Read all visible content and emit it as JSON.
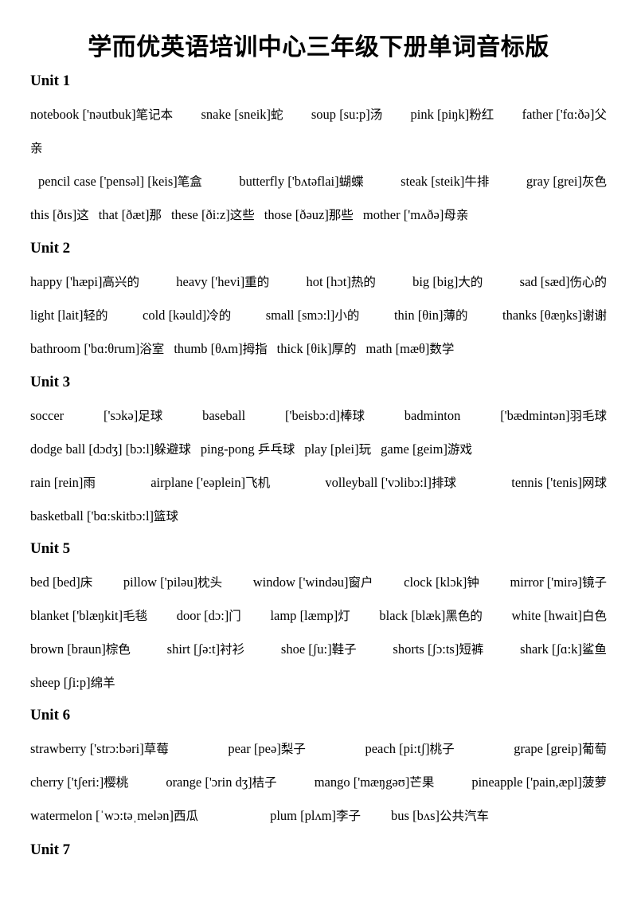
{
  "title": "学而优英语培训中心三年级下册单词音标版",
  "units": [
    {
      "label": "Unit 1",
      "lines": [
        [
          {
            "en": "notebook",
            "ph": "['nəutbuk]",
            "zh": "笔记本"
          },
          {
            "en": "snake",
            "ph": "[sneik]",
            "zh": "蛇"
          },
          {
            "en": "soup",
            "ph": "[su:p]",
            "zh": "汤"
          },
          {
            "en": "pink",
            "ph": "[piŋk]",
            "zh": "粉红"
          },
          {
            "en": "father",
            "ph": "['fɑ:ðə]",
            "zh": "父"
          }
        ],
        [
          {
            "en": "",
            "ph": "",
            "zh": "亲"
          }
        ],
        [
          {
            "en": "pencil case",
            "ph": "['pensəl] [keis]",
            "zh": "笔盒"
          },
          {
            "en": "butterfly",
            "ph": "['bʌtəflai]",
            "zh": "蝴蝶"
          },
          {
            "en": "steak",
            "ph": "[steik]",
            "zh": "牛排"
          },
          {
            "en": "gray",
            "ph": "[grei]",
            "zh": "灰色"
          }
        ],
        [
          {
            "en": "this",
            "ph": "[ðɪs]",
            "zh": "这"
          },
          {
            "en": "that",
            "ph": "[ðæt]",
            "zh": "那"
          },
          {
            "en": "these",
            "ph": "[ði:z]",
            "zh": "这些"
          },
          {
            "en": "those",
            "ph": "[ðəuz]",
            "zh": "那些"
          },
          {
            "en": "mother",
            "ph": "['mʌðə]",
            "zh": "母亲"
          }
        ]
      ]
    },
    {
      "label": "Unit 2",
      "lines": [
        [
          {
            "en": "happy",
            "ph": "['hæpi]",
            "zh": "高兴的"
          },
          {
            "en": "heavy",
            "ph": "['hevi]",
            "zh": "重的"
          },
          {
            "en": "hot",
            "ph": "[hɔt]",
            "zh": "热的"
          },
          {
            "en": "big",
            "ph": "[big]",
            "zh": "大的"
          },
          {
            "en": "sad",
            "ph": "[sæd]",
            "zh": "伤心的"
          }
        ],
        [
          {
            "en": "light",
            "ph": "[lait]",
            "zh": "轻的"
          },
          {
            "en": "cold",
            "ph": "[kəuld]",
            "zh": "冷的"
          },
          {
            "en": "small",
            "ph": "[smɔ:l]",
            "zh": "小的"
          },
          {
            "en": "thin",
            "ph": "[θin]",
            "zh": "薄的"
          },
          {
            "en": "thanks",
            "ph": "[θæŋks]",
            "zh": "谢谢"
          }
        ],
        [
          {
            "en": "bathroom",
            "ph": "['bɑ:θrum]",
            "zh": "浴室"
          },
          {
            "en": "thumb",
            "ph": "[θʌm]",
            "zh": "拇指"
          },
          {
            "en": "thick",
            "ph": "[θik]",
            "zh": "厚的"
          },
          {
            "en": "math",
            "ph": "[mæθ]",
            "zh": "数学"
          }
        ]
      ]
    },
    {
      "label": "Unit 3",
      "lines": [
        [
          {
            "en": "soccer",
            "ph": "",
            "zh": ""
          },
          {
            "en": "",
            "ph": "['sɔkə]",
            "zh": "足球"
          },
          {
            "en": "baseball",
            "ph": "",
            "zh": ""
          },
          {
            "en": "",
            "ph": "['beisbɔ:d]",
            "zh": "棒球"
          },
          {
            "en": "badminton",
            "ph": "",
            "zh": ""
          },
          {
            "en": "",
            "ph": "['bædmintən]",
            "zh": "羽毛球"
          }
        ],
        [
          {
            "en": "dodge ball",
            "ph": "[dɔdʒ] [bɔ:l]",
            "zh": "躲避球"
          },
          {
            "en": "ping-pong",
            "ph": "",
            "zh": "乒乓球"
          },
          {
            "en": "play",
            "ph": "[plei]",
            "zh": "玩"
          },
          {
            "en": "game",
            "ph": "[geim]",
            "zh": "游戏"
          }
        ],
        [
          {
            "en": "rain",
            "ph": "[rein]",
            "zh": "雨"
          },
          {
            "en": "airplane",
            "ph": "['eəplein]",
            "zh": "飞机"
          },
          {
            "en": "volleyball",
            "ph": "['vɔlibɔ:l]",
            "zh": "排球"
          },
          {
            "en": "tennis",
            "ph": "['tenis]",
            "zh": "网球"
          }
        ],
        [
          {
            "en": "basketball",
            "ph": "['bɑ:skitbɔ:l]",
            "zh": "篮球"
          }
        ]
      ]
    },
    {
      "label": "Unit 5",
      "lines": [
        [
          {
            "en": "bed",
            "ph": "[bed]",
            "zh": "床"
          },
          {
            "en": "pillow",
            "ph": "['piləu]",
            "zh": "枕头"
          },
          {
            "en": "window",
            "ph": "['windəu]",
            "zh": "窗户"
          },
          {
            "en": "clock",
            "ph": "[klɔk]",
            "zh": "钟"
          },
          {
            "en": "mirror",
            "ph": "['mirə]",
            "zh": "镜子"
          }
        ],
        [
          {
            "en": "blanket",
            "ph": "['blæŋkit]",
            "zh": "毛毯"
          },
          {
            "en": "door",
            "ph": "[dɔ:]",
            "zh": "门"
          },
          {
            "en": "lamp",
            "ph": "[læmp]",
            "zh": "灯"
          },
          {
            "en": "black",
            "ph": "[blæk]",
            "zh": "黑色的"
          },
          {
            "en": "white",
            "ph": "[hwait]",
            "zh": "白色"
          }
        ],
        [
          {
            "en": "brown",
            "ph": "[braun]",
            "zh": "棕色"
          },
          {
            "en": "shirt",
            "ph": "[ʃə:t]",
            "zh": "衬衫"
          },
          {
            "en": "shoe",
            "ph": "[ʃu:]",
            "zh": "鞋子"
          },
          {
            "en": "shorts",
            "ph": "[ʃɔ:ts]",
            "zh": "短裤"
          },
          {
            "en": "shark",
            "ph": "[ʃɑ:k]",
            "zh": "鲨鱼"
          }
        ],
        [
          {
            "en": "sheep",
            "ph": "[ʃi:p]",
            "zh": "绵羊"
          }
        ]
      ]
    },
    {
      "label": "Unit 6",
      "lines": [
        [
          {
            "en": "strawberry",
            "ph": "['strɔ:bəri]",
            "zh": "草莓"
          },
          {
            "en": "pear",
            "ph": "[peə]",
            "zh": "梨子"
          },
          {
            "en": "peach",
            "ph": "[pi:tʃ]",
            "zh": "桃子"
          },
          {
            "en": "grape",
            "ph": "[greip]",
            "zh": "葡萄"
          }
        ],
        [
          {
            "en": "cherry",
            "ph": "['tʃeri:]",
            "zh": "樱桃"
          },
          {
            "en": "orange",
            "ph": "['ɔrin dʒ]",
            "zh": "桔子"
          },
          {
            "en": "mango",
            "ph": "['mæŋgəʊ]",
            "zh": "芒果"
          },
          {
            "en": "pineapple",
            "ph": "['pain,æpl]",
            "zh": "菠萝"
          }
        ],
        [
          {
            "en": "watermelon",
            "ph": "[ˈwɔ:təˌmelən]",
            "zh": "西瓜"
          },
          {
            "en": "plum",
            "ph": "[plʌm]",
            "zh": "李子"
          },
          {
            "en": "bus",
            "ph": "[bʌs]",
            "zh": "公共汽车"
          }
        ]
      ]
    },
    {
      "label": "Unit 7",
      "lines": []
    }
  ]
}
